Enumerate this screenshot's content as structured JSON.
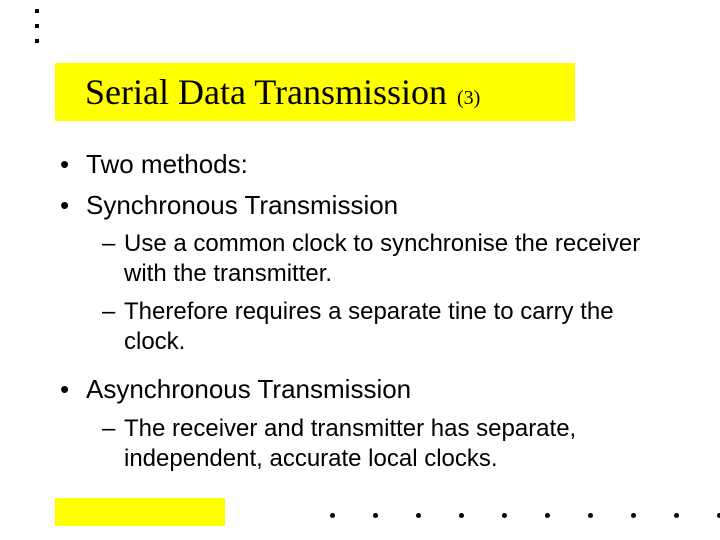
{
  "title": {
    "main": "Serial Data Transmission",
    "num": "(3)"
  },
  "content": {
    "b1": "Two methods:",
    "b2": "Synchronous Transmission",
    "b2_sub": [
      "Use a common clock to synchronise the receiver with the transmitter.",
      "Therefore requires a separate tine to carry the clock."
    ],
    "b3": "Asynchronous Transmission",
    "b3_sub": [
      "The receiver and transmitter has separate, independent, accurate local clocks."
    ]
  },
  "markers": {
    "l1": "•",
    "l2": "–"
  }
}
